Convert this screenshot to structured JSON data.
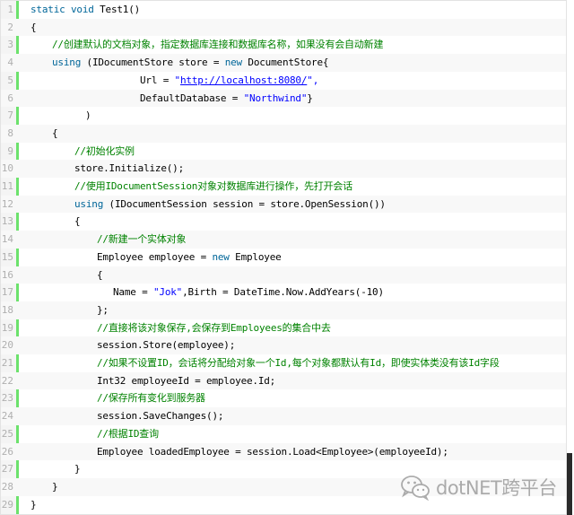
{
  "code": {
    "line_numbers": [
      "1",
      "2",
      "3",
      "4",
      "5",
      "6",
      "7",
      "8",
      "9",
      "10",
      "11",
      "12",
      "13",
      "14",
      "15",
      "16",
      "17",
      "18",
      "19",
      "20",
      "21",
      "22",
      "23",
      "24",
      "25",
      "26",
      "27",
      "28",
      "29"
    ],
    "lines": {
      "l1": [
        "static",
        " ",
        "void",
        " Test1()"
      ],
      "l2": "{",
      "l3": "//创建默认的文档对象，指定数据库连接和数据库名称，如果没有会自动新建",
      "l4": [
        "using",
        " (IDocumentStore store = ",
        "new",
        " DocumentStore{"
      ],
      "l5": [
        "Url = ",
        "\"",
        "http://localhost:8080/",
        "\","
      ],
      "l6": [
        "DefaultDatabase = ",
        "\"Northwind\"",
        "}"
      ],
      "l7": ")",
      "l8": "{",
      "l9": "//初始化实例",
      "l10": "store.Initialize();",
      "l11": "//使用IDocumentSession对象对数据库进行操作，先打开会话",
      "l12": [
        "using",
        " (IDocumentSession session = store.OpenSession())"
      ],
      "l13": "{",
      "l14": "//新建一个实体对象",
      "l15": [
        "Employee employee = ",
        "new",
        " Employee"
      ],
      "l16": "{",
      "l17": [
        "Name = ",
        "\"Jok\"",
        ",Birth = DateTime.Now.AddYears(-10)"
      ],
      "l18": "};",
      "l19": "//直接将该对象保存,会保存到Employees的集合中去",
      "l20": "session.Store(employee);",
      "l21": "//如果不设置ID，会话将分配给对象一个Id,每个对象都默认有Id，即使实体类没有该Id字段",
      "l22": "Int32 employeeId = employee.Id;",
      "l23": "//保存所有变化到服务器",
      "l24": "session.SaveChanges();",
      "l25": "//根据ID查询",
      "l26": "Employee loadedEmployee = session.Load<Employee>(employeeId);",
      "l27": "}",
      "l28": "}",
      "l29": "}"
    }
  },
  "watermark": {
    "text": "dotNET跨平台",
    "icon": "wechat-icon"
  },
  "colors": {
    "keyword": "#006699",
    "string": "#0000ff",
    "comment": "#008200",
    "gutter_bar": "#6ce26c"
  }
}
